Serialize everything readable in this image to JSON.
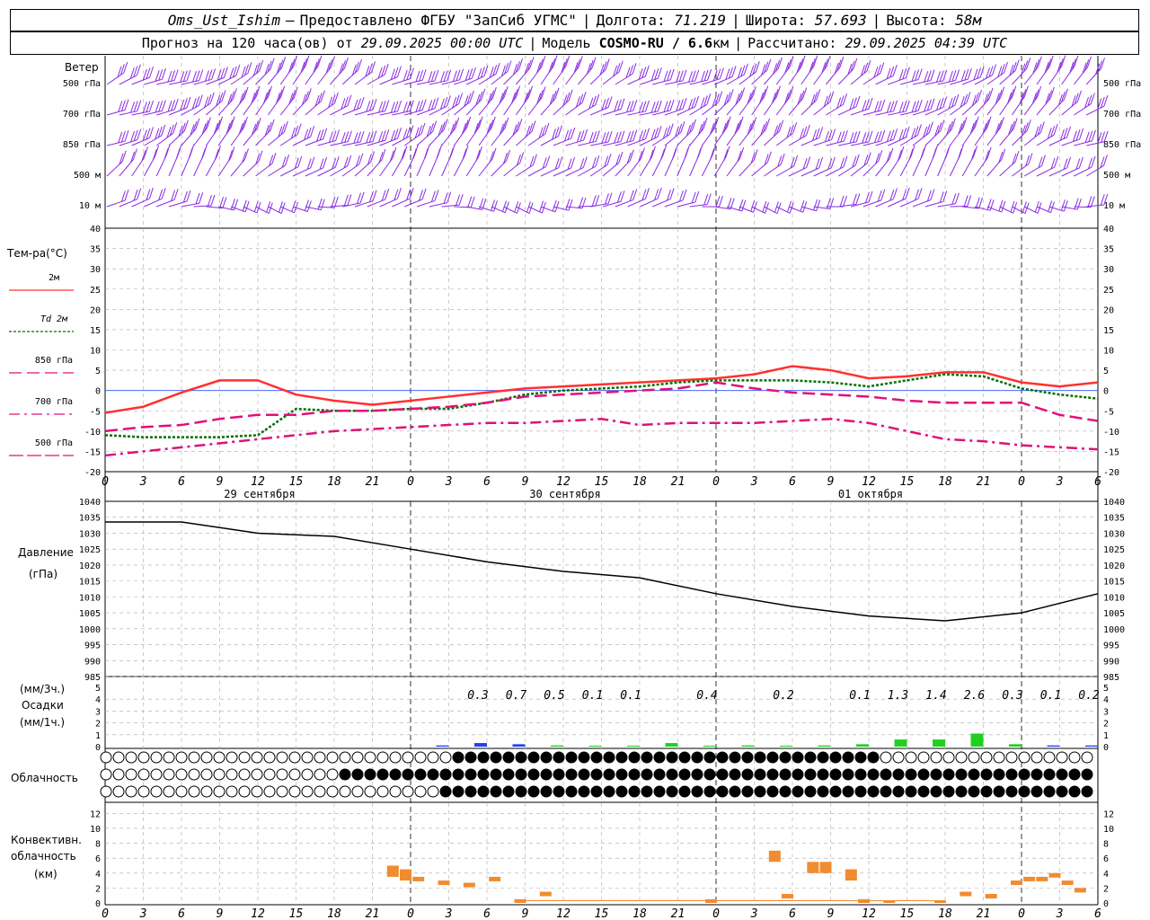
{
  "header": {
    "station": "Oms_Ust_Ishim",
    "dash": "–",
    "provider": "Предоставлено ФГБУ \"ЗапСиб УГМС\"",
    "lon_label": "Долгота:",
    "lon": "71.219",
    "lat_label": "Широта:",
    "lat": "57.693",
    "alt_label": "Высота:",
    "alt": "58м",
    "forecast_label": "Прогноз на 120 часа(ов) от",
    "forecast_time": "29.09.2025 00:00 UTC",
    "model_label": "Модель",
    "model": "COSMO-RU / 6.6",
    "model_unit": "км",
    "calc_label": "Рассчитано:",
    "calc_time": "29.09.2025 04:39 UTC"
  },
  "wind": {
    "title": "Ветер",
    "levels": [
      "500 гПа",
      "700 гПа",
      "850 гПа",
      "500 м",
      "10  м"
    ],
    "color": "#8a2be2"
  },
  "hour_ticks": [
    "0",
    "3",
    "6",
    "9",
    "12",
    "15",
    "18",
    "21",
    "0",
    "3",
    "6",
    "9",
    "12",
    "15",
    "18",
    "21",
    "0",
    "3",
    "6",
    "9",
    "12",
    "15",
    "18",
    "21",
    "0",
    "3",
    "6"
  ],
  "dates": [
    "29 сентября",
    "30 сентября",
    "01 октября"
  ],
  "temperature": {
    "title": "Тем-ра(°C)",
    "legend": [
      {
        "label": "2м",
        "color": "#ff3030",
        "style": "solid"
      },
      {
        "label": "Td  2м",
        "color": "#007000",
        "style": "dotted"
      },
      {
        "label": "850 гПа",
        "color": "#e0107a",
        "style": "dash"
      },
      {
        "label": "700 гПа",
        "color": "#e0107a",
        "style": "dashdot"
      },
      {
        "label": "500 гПа",
        "color": "#e0107a",
        "style": "longdash"
      }
    ],
    "y_ticks": [
      "40",
      "35",
      "30",
      "25",
      "20",
      "15",
      "10",
      "5",
      "0",
      "-5",
      "-10",
      "-15",
      "-20"
    ]
  },
  "pressure": {
    "title": "Давление",
    "unit": "(гПа)",
    "y_ticks": [
      "1040",
      "1035",
      "1030",
      "1025",
      "1020",
      "1015",
      "1010",
      "1005",
      "1000",
      "995",
      "990",
      "985"
    ]
  },
  "precip": {
    "unit1": "(мм/3ч.)",
    "title": "Осадки",
    "unit2": "(мм/1ч.)",
    "y_ticks": [
      "5",
      "4",
      "3",
      "2",
      "1",
      "0"
    ],
    "totals": [
      "0.3",
      "0.7",
      "0.5",
      "0.1",
      "0.1",
      "0.4",
      "0.2",
      "0.1",
      "1.3",
      "1.4",
      "2.6",
      "0.3",
      "0.1",
      "0.2"
    ]
  },
  "cloud": {
    "title": "Облачность"
  },
  "convective": {
    "title1": "Конвективн.",
    "title2": "облачность",
    "unit": "(км)",
    "y_ticks": [
      "12",
      "10",
      "8",
      "6",
      "4",
      "2",
      "0"
    ]
  },
  "chart_data": [
    {
      "type": "line",
      "title": "Тем-ра(°C)",
      "x_hours": [
        0,
        3,
        6,
        9,
        12,
        15,
        18,
        21,
        24,
        27,
        30,
        33,
        36,
        39,
        42,
        45,
        48,
        51,
        54,
        57,
        60,
        63,
        66,
        69,
        72,
        75,
        78
      ],
      "ylim": [
        -20,
        40
      ],
      "series": [
        {
          "name": "2м",
          "values": [
            -5.5,
            -4,
            -0.5,
            2.5,
            2.5,
            -1,
            -2.5,
            -3.5,
            -2.5,
            -1.5,
            -0.5,
            0.5,
            1,
            1.5,
            2,
            2.5,
            3,
            4,
            6,
            5,
            3,
            3.5,
            4.5,
            4.5,
            2,
            1,
            2
          ]
        },
        {
          "name": "Td  2м",
          "values": [
            -11,
            -11.5,
            -11.5,
            -11.5,
            -11,
            -4.5,
            -5,
            -5,
            -4.5,
            -4.5,
            -3,
            -1,
            0,
            0.5,
            1,
            2,
            2.5,
            2.5,
            2.5,
            2,
            1,
            2.5,
            4,
            3.5,
            0.5,
            -1,
            -2
          ]
        },
        {
          "name": "850 гПа",
          "values": [
            -10,
            -9,
            -8.5,
            -7,
            -6,
            -6,
            -5,
            -5,
            -4.5,
            -4,
            -3,
            -1.5,
            -1,
            -0.5,
            0,
            0.5,
            2,
            0.5,
            -0.5,
            -1,
            -1.5,
            -2.5,
            -3,
            -3,
            -3,
            -6,
            -7.5
          ]
        },
        {
          "name": "700 гПа",
          "values": [
            -16,
            -15,
            -14,
            -13,
            -12,
            -11,
            -10,
            -9.5,
            -9,
            -8.5,
            -8,
            -8,
            -7.5,
            -7,
            -8.5,
            -8,
            -8,
            -8,
            -7.5,
            -7,
            -8,
            -10,
            -12,
            -12.5,
            -13.5,
            -14,
            -14.5
          ]
        }
      ]
    },
    {
      "type": "line",
      "title": "Давление",
      "x_hours": [
        0,
        6,
        12,
        18,
        24,
        30,
        36,
        42,
        48,
        54,
        60,
        66,
        72,
        78
      ],
      "ylim": [
        985,
        1040
      ],
      "series": [
        {
          "name": "Давление",
          "values": [
            1033.5,
            1033.5,
            1030,
            1029,
            1025,
            1021,
            1018,
            1016,
            1011,
            1007,
            1004,
            1002.5,
            1005,
            1011
          ]
        }
      ]
    },
    {
      "type": "bar",
      "title": "Осадки",
      "ylim": [
        0,
        5
      ],
      "x_hours": [
        27,
        30,
        33,
        36,
        39,
        42,
        45,
        48,
        51,
        54,
        57,
        60,
        63,
        66,
        69,
        72,
        75,
        78
      ],
      "values": [
        0.1,
        0.3,
        0.2,
        0.1,
        0.05,
        0.05,
        0.3,
        0.05,
        0.1,
        0.0,
        0.1,
        0.2,
        0.6,
        0.6,
        1.1,
        0.2,
        0.1,
        0.1
      ]
    },
    {
      "type": "bar",
      "title": "Конвективн. облачность",
      "ylim": [
        0,
        13
      ],
      "x_hours": [
        23,
        24,
        25,
        27,
        29,
        31,
        33,
        35,
        48,
        53,
        54,
        56,
        57,
        59,
        60,
        62,
        66,
        68,
        70,
        72,
        73,
        74,
        75,
        76,
        77
      ],
      "values": [
        5,
        4.5,
        3.5,
        3,
        2.7,
        3.5,
        0.5,
        1.5,
        0.5,
        7,
        1.2,
        5.5,
        5.5,
        4.5,
        0.5,
        0.3,
        0.3,
        1.5,
        1.2,
        3,
        3.5,
        3.5,
        4,
        3,
        2
      ]
    }
  ]
}
